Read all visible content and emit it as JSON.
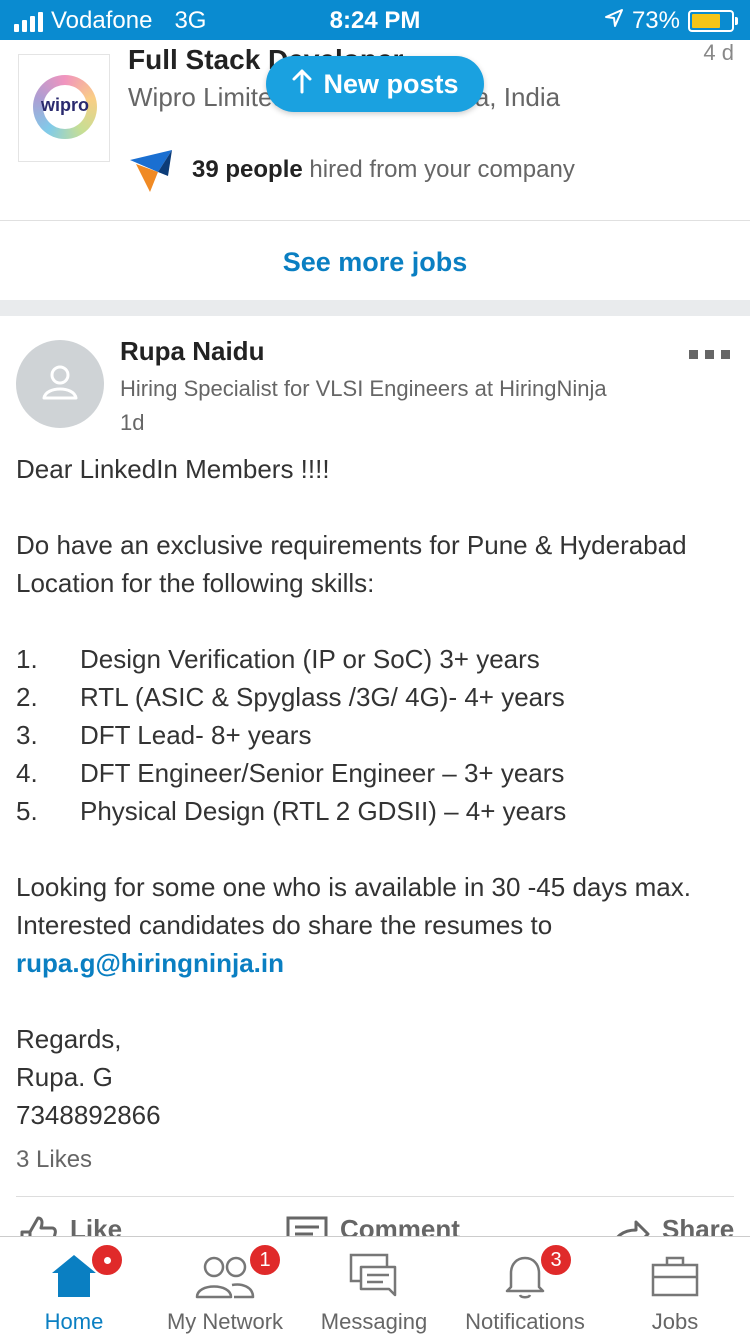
{
  "status_bar": {
    "carrier": "Vodafone",
    "network": "3G",
    "time": "8:24 PM",
    "battery_percent": "73%",
    "battery_level": 0.73
  },
  "job": {
    "logo_text": "wipro",
    "title": "Full Stack Developer",
    "company_location": "Wipro Limited · Bangalore Area, India",
    "time": "4 d",
    "hired_count": "39 people",
    "hired_text": "hired from your company"
  },
  "new_posts_label": "New posts",
  "see_more_jobs": "See more jobs",
  "post": {
    "author": "Rupa Naidu",
    "headline": "Hiring Specialist for VLSI Engineers at HiringNinja",
    "time": "1d",
    "greeting": "Dear LinkedIn Members !!!!",
    "intro": "Do have an exclusive requirements for Pune & Hyderabad Location for the following skills:",
    "skills": [
      {
        "num": "1.",
        "text": "Design Verification (IP or SoC) 3+ years"
      },
      {
        "num": "2.",
        "text": "RTL (ASIC & Spyglass /3G/ 4G)- 4+ years"
      },
      {
        "num": "3.",
        "text": "DFT Lead- 8+ years"
      },
      {
        "num": "4.",
        "text": "DFT Engineer/Senior Engineer – 3+ years"
      },
      {
        "num": "5.",
        "text": "Physical Design (RTL 2 GDSII) – 4+ years"
      }
    ],
    "closing_line1": "Looking for some one who is available in 30 -45 days max.",
    "closing_line2": "Interested candidates do share the resumes to",
    "email": "rupa.g@hiringninja.in",
    "regards": "Regards,",
    "signature_name": "Rupa. G",
    "phone": "7348892866",
    "likes": "3 Likes",
    "actions": {
      "like": "Like",
      "comment": "Comment",
      "share": "Share"
    }
  },
  "tabs": [
    {
      "label": "Home",
      "icon": "home-icon",
      "badge": ""
    },
    {
      "label": "My Network",
      "icon": "network-icon",
      "badge": "1"
    },
    {
      "label": "Messaging",
      "icon": "messaging-icon",
      "badge": ""
    },
    {
      "label": "Notifications",
      "icon": "bell-icon",
      "badge": "3"
    },
    {
      "label": "Jobs",
      "icon": "briefcase-icon",
      "badge": ""
    }
  ],
  "colors": {
    "brand_blue": "#0a8bd0",
    "link_blue": "#0a7fc2",
    "badge_red": "#e02a2a"
  }
}
